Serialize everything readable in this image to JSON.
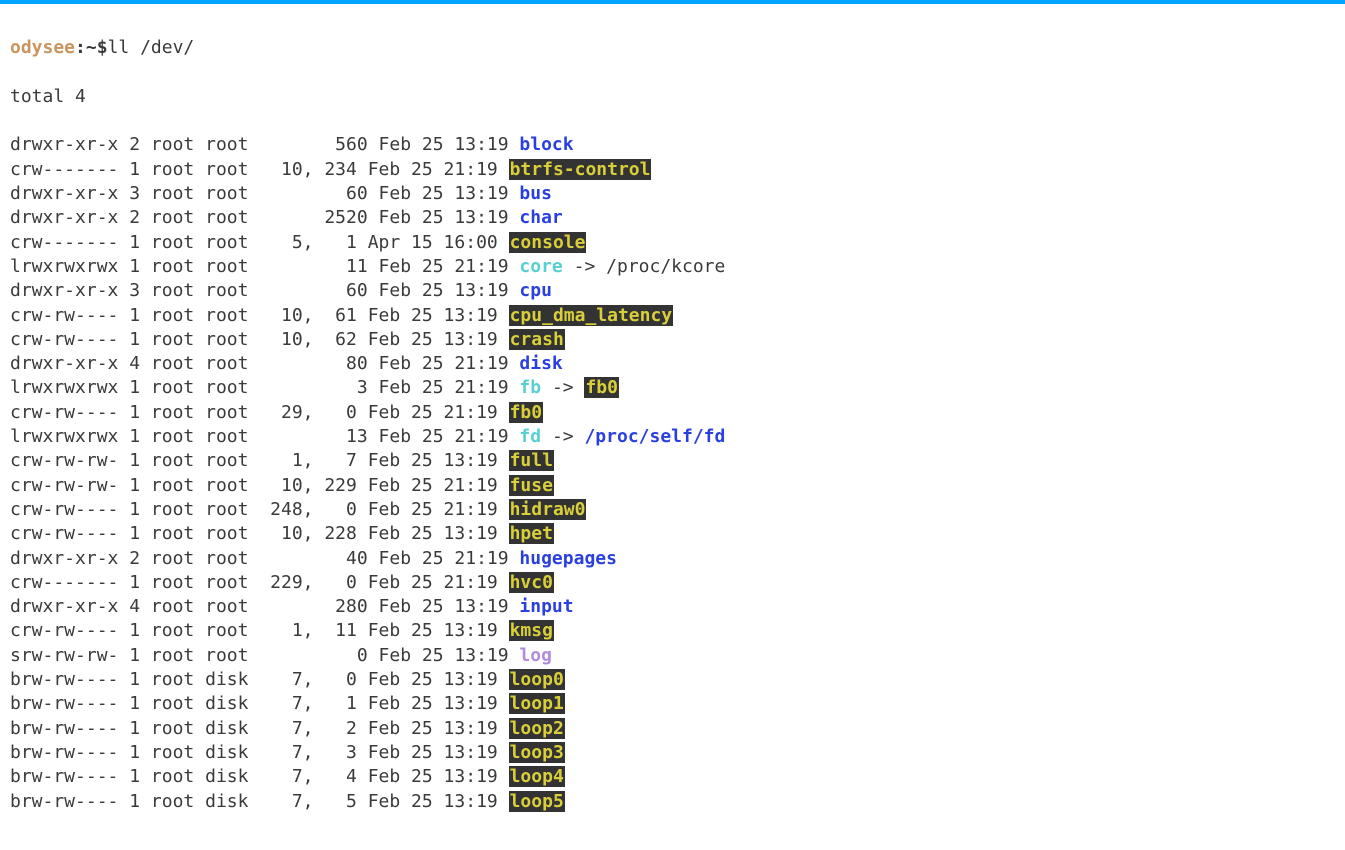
{
  "prompt": {
    "user": "odysee",
    "sep": ":",
    "path": "~",
    "dollar": "$",
    "command": "ll /dev/"
  },
  "total_line": "total 4",
  "rows": [
    {
      "perms": "drwxr-xr-x",
      "links": "2",
      "owner": "root",
      "group": "root",
      "size": "       560",
      "date": "Feb 25 13:19",
      "name": "block",
      "class": "dir"
    },
    {
      "perms": "crw-------",
      "links": "1",
      "owner": "root",
      "group": "root",
      "size": "  10, 234",
      "date": "Feb 25 21:19",
      "name": "btrfs-control",
      "class": "dev"
    },
    {
      "perms": "drwxr-xr-x",
      "links": "3",
      "owner": "root",
      "group": "root",
      "size": "        60",
      "date": "Feb 25 13:19",
      "name": "bus",
      "class": "dir"
    },
    {
      "perms": "drwxr-xr-x",
      "links": "2",
      "owner": "root",
      "group": "root",
      "size": "      2520",
      "date": "Feb 25 13:19",
      "name": "char",
      "class": "dir"
    },
    {
      "perms": "crw-------",
      "links": "1",
      "owner": "root",
      "group": "root",
      "size": "   5,   1",
      "date": "Apr 15 16:00",
      "name": "console",
      "class": "dev"
    },
    {
      "perms": "lrwxrwxrwx",
      "links": "1",
      "owner": "root",
      "group": "root",
      "size": "        11",
      "date": "Feb 25 21:19",
      "name": "core",
      "class": "sym",
      "target": "/proc/kcore",
      "target_class": "tgt-plain"
    },
    {
      "perms": "drwxr-xr-x",
      "links": "3",
      "owner": "root",
      "group": "root",
      "size": "        60",
      "date": "Feb 25 13:19",
      "name": "cpu",
      "class": "dir"
    },
    {
      "perms": "crw-rw----",
      "links": "1",
      "owner": "root",
      "group": "root",
      "size": "  10,  61",
      "date": "Feb 25 13:19",
      "name": "cpu_dma_latency",
      "class": "dev"
    },
    {
      "perms": "crw-rw----",
      "links": "1",
      "owner": "root",
      "group": "root",
      "size": "  10,  62",
      "date": "Feb 25 13:19",
      "name": "crash",
      "class": "dev"
    },
    {
      "perms": "drwxr-xr-x",
      "links": "4",
      "owner": "root",
      "group": "root",
      "size": "        80",
      "date": "Feb 25 21:19",
      "name": "disk",
      "class": "dir"
    },
    {
      "perms": "lrwxrwxrwx",
      "links": "1",
      "owner": "root",
      "group": "root",
      "size": "         3",
      "date": "Feb 25 21:19",
      "name": "fb",
      "class": "sym",
      "target": "fb0",
      "target_class": "tgt-dev"
    },
    {
      "perms": "crw-rw----",
      "links": "1",
      "owner": "root",
      "group": "root",
      "size": "  29,   0",
      "date": "Feb 25 21:19",
      "name": "fb0",
      "class": "dev"
    },
    {
      "perms": "lrwxrwxrwx",
      "links": "1",
      "owner": "root",
      "group": "root",
      "size": "        13",
      "date": "Feb 25 21:19",
      "name": "fd",
      "class": "sym",
      "target": "/proc/self/fd",
      "target_class": "tgt-dir"
    },
    {
      "perms": "crw-rw-rw-",
      "links": "1",
      "owner": "root",
      "group": "root",
      "size": "   1,   7",
      "date": "Feb 25 13:19",
      "name": "full",
      "class": "dev"
    },
    {
      "perms": "crw-rw-rw-",
      "links": "1",
      "owner": "root",
      "group": "root",
      "size": "  10, 229",
      "date": "Feb 25 21:19",
      "name": "fuse",
      "class": "dev"
    },
    {
      "perms": "crw-rw----",
      "links": "1",
      "owner": "root",
      "group": "root",
      "size": " 248,   0",
      "date": "Feb 25 21:19",
      "name": "hidraw0",
      "class": "dev"
    },
    {
      "perms": "crw-rw----",
      "links": "1",
      "owner": "root",
      "group": "root",
      "size": "  10, 228",
      "date": "Feb 25 13:19",
      "name": "hpet",
      "class": "dev"
    },
    {
      "perms": "drwxr-xr-x",
      "links": "2",
      "owner": "root",
      "group": "root",
      "size": "        40",
      "date": "Feb 25 21:19",
      "name": "hugepages",
      "class": "dir"
    },
    {
      "perms": "crw-------",
      "links": "1",
      "owner": "root",
      "group": "root",
      "size": " 229,   0",
      "date": "Feb 25 21:19",
      "name": "hvc0",
      "class": "dev"
    },
    {
      "perms": "drwxr-xr-x",
      "links": "4",
      "owner": "root",
      "group": "root",
      "size": "       280",
      "date": "Feb 25 13:19",
      "name": "input",
      "class": "dir"
    },
    {
      "perms": "crw-rw----",
      "links": "1",
      "owner": "root",
      "group": "root",
      "size": "   1,  11",
      "date": "Feb 25 13:19",
      "name": "kmsg",
      "class": "dev"
    },
    {
      "perms": "srw-rw-rw-",
      "links": "1",
      "owner": "root",
      "group": "root",
      "size": "         0",
      "date": "Feb 25 13:19",
      "name": "log",
      "class": "sock"
    },
    {
      "perms": "brw-rw----",
      "links": "1",
      "owner": "root",
      "group": "disk",
      "size": "   7,   0",
      "date": "Feb 25 13:19",
      "name": "loop0",
      "class": "dev"
    },
    {
      "perms": "brw-rw----",
      "links": "1",
      "owner": "root",
      "group": "disk",
      "size": "   7,   1",
      "date": "Feb 25 13:19",
      "name": "loop1",
      "class": "dev"
    },
    {
      "perms": "brw-rw----",
      "links": "1",
      "owner": "root",
      "group": "disk",
      "size": "   7,   2",
      "date": "Feb 25 13:19",
      "name": "loop2",
      "class": "dev"
    },
    {
      "perms": "brw-rw----",
      "links": "1",
      "owner": "root",
      "group": "disk",
      "size": "   7,   3",
      "date": "Feb 25 13:19",
      "name": "loop3",
      "class": "dev"
    },
    {
      "perms": "brw-rw----",
      "links": "1",
      "owner": "root",
      "group": "disk",
      "size": "   7,   4",
      "date": "Feb 25 13:19",
      "name": "loop4",
      "class": "dev"
    },
    {
      "perms": "brw-rw----",
      "links": "1",
      "owner": "root",
      "group": "disk",
      "size": "   7,   5",
      "date": "Feb 25 13:19",
      "name": "loop5",
      "class": "dev"
    }
  ]
}
